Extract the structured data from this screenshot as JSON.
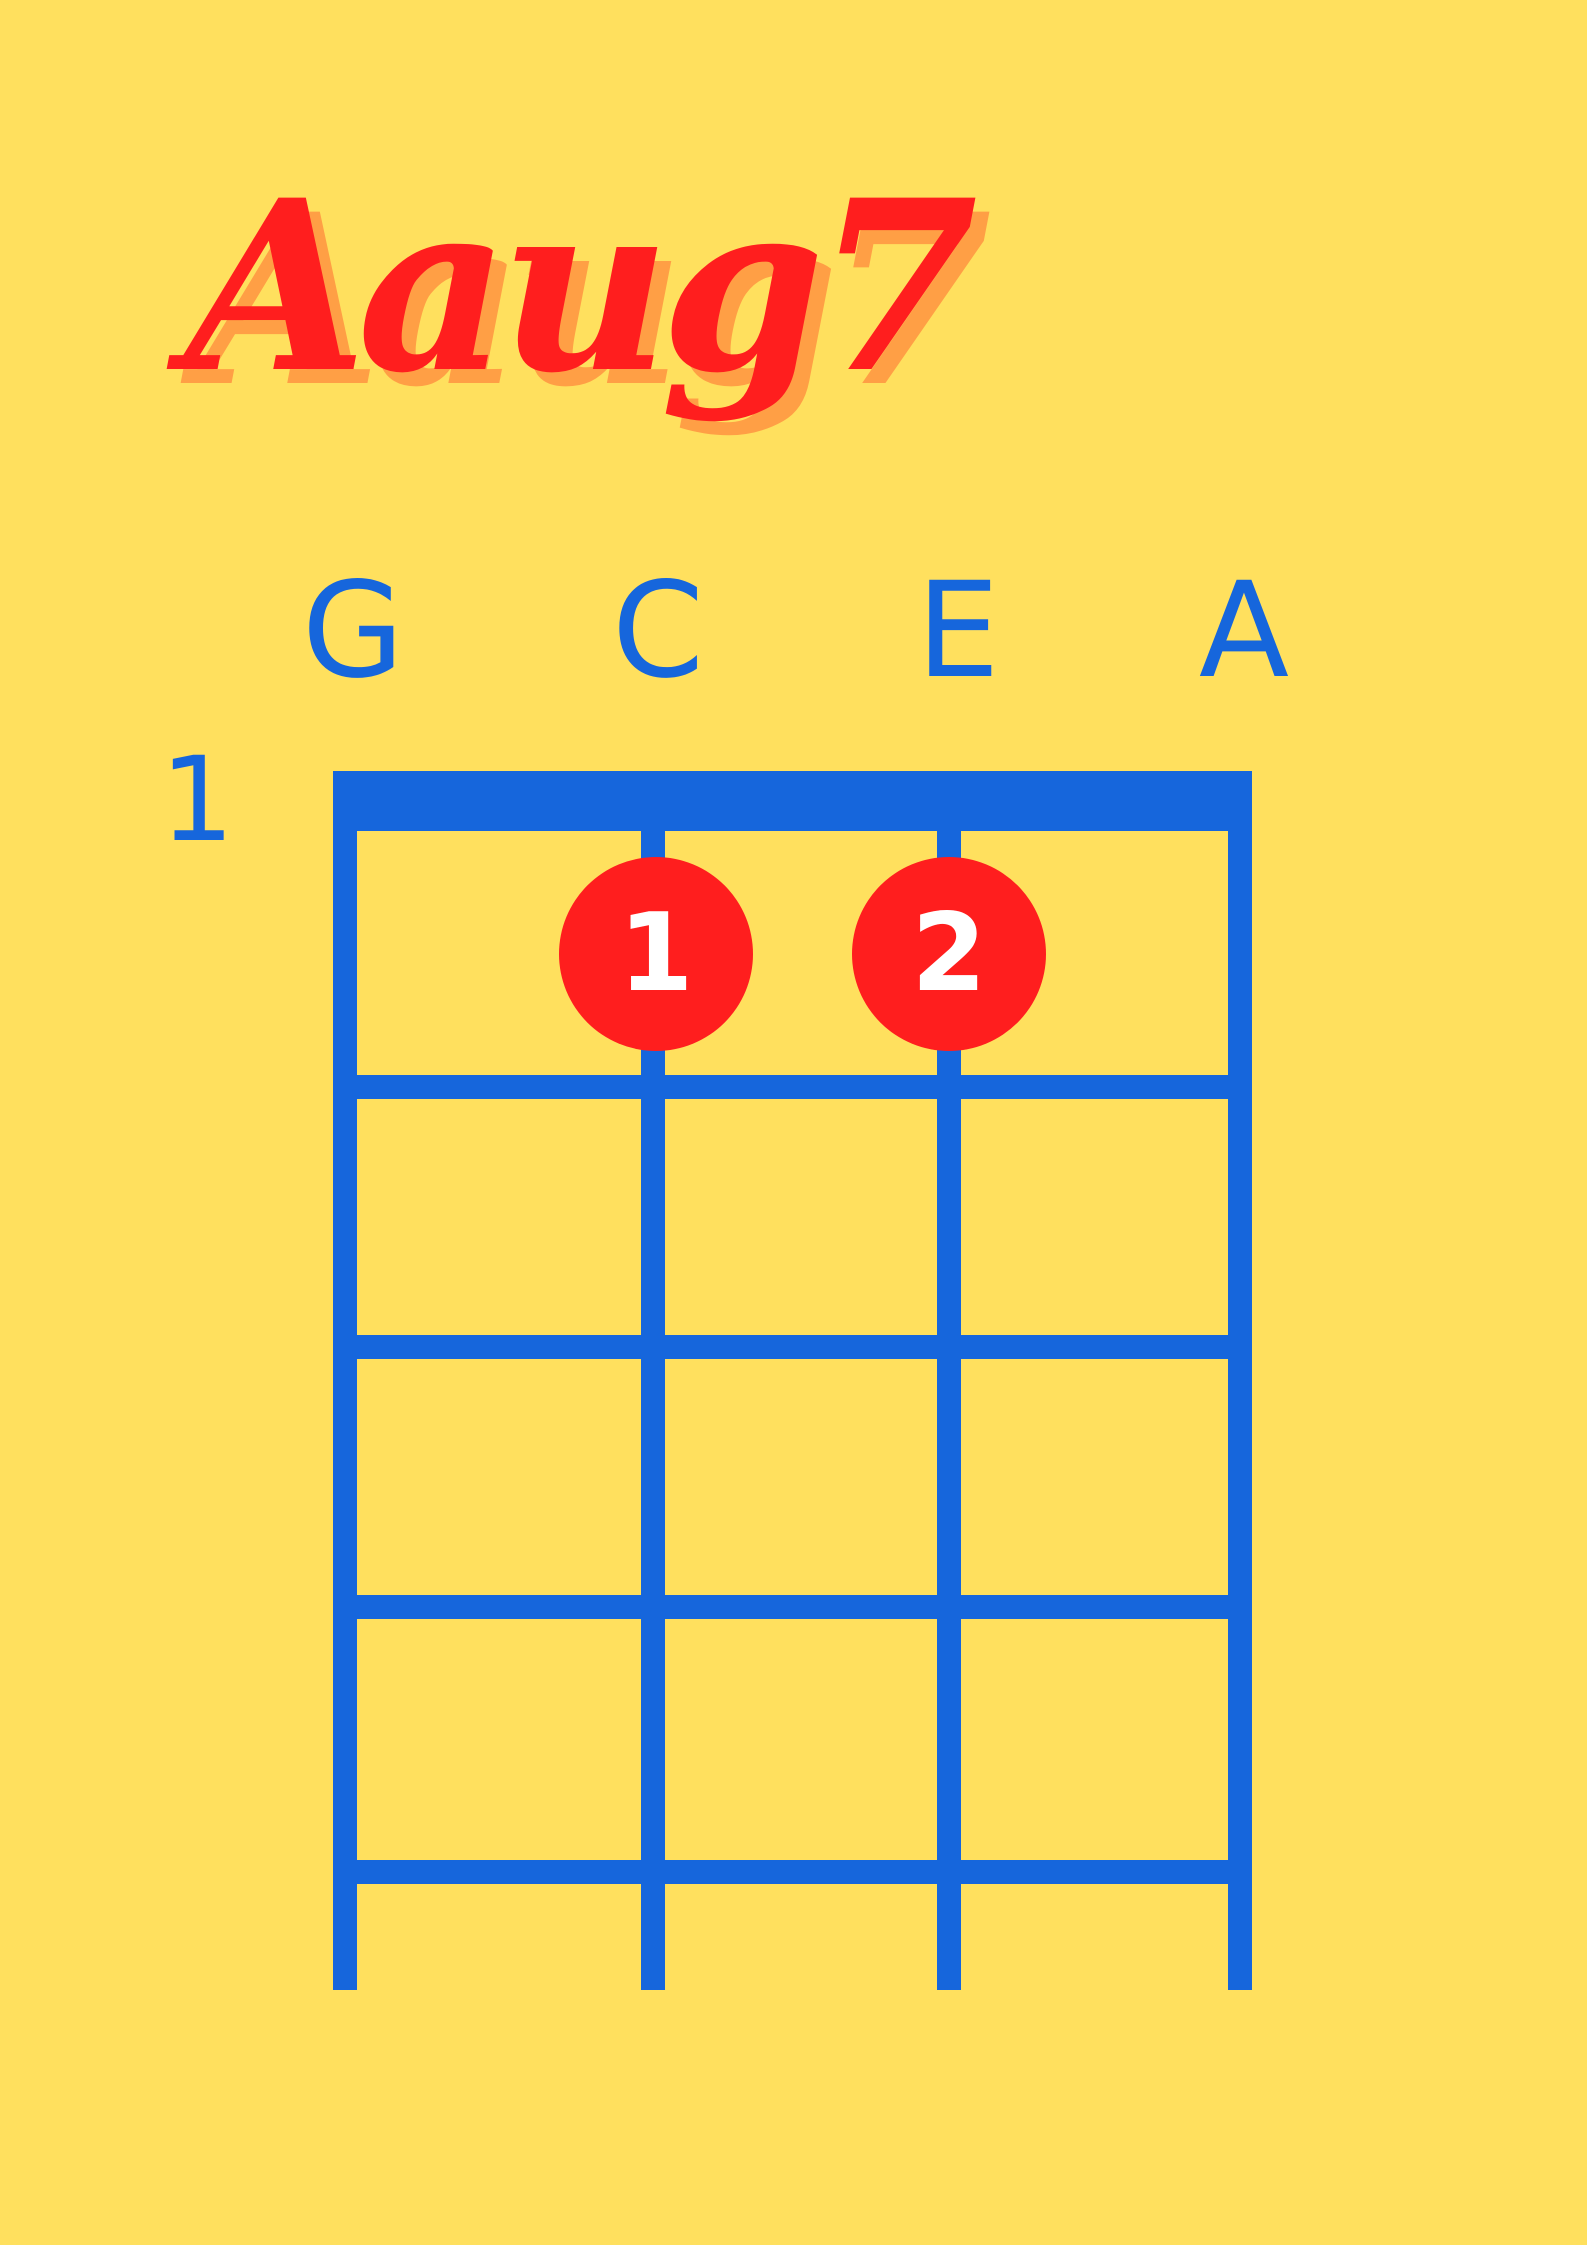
{
  "chord": {
    "name": "Aaug7"
  },
  "strings": [
    {
      "name": "G"
    },
    {
      "name": "C"
    },
    {
      "name": "E"
    },
    {
      "name": "A"
    }
  ],
  "start_fret_label": "1",
  "finger_positions": [
    {
      "string": "C",
      "fret": 1,
      "finger": "1"
    },
    {
      "string": "E",
      "fret": 1,
      "finger": "2"
    }
  ],
  "colors": {
    "background": "#FFE05E",
    "title_primary": "#FF1E1E",
    "title_shadow": "#FF9F45",
    "diagram": "#1666DC",
    "marker": "#FF1E1E",
    "marker_text": "#FFFFFF"
  }
}
